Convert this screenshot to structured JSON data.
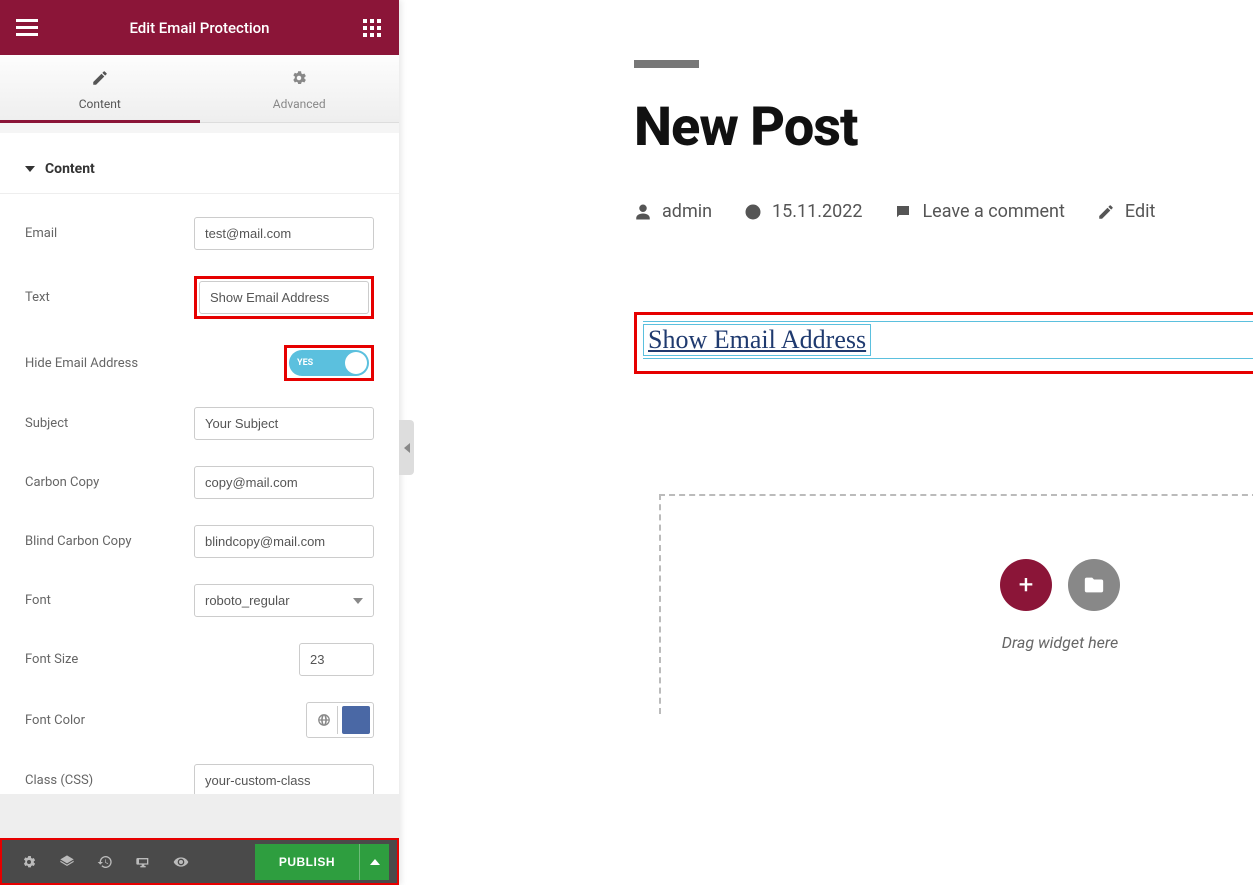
{
  "sidebar": {
    "title": "Edit Email Protection",
    "tabs": {
      "content": "Content",
      "advanced": "Advanced"
    },
    "section": "Content",
    "fields": {
      "email_label": "Email",
      "email_value": "test@mail.com",
      "text_label": "Text",
      "text_value": "Show Email Address",
      "hide_label": "Hide Email Address",
      "hide_toggle": "YES",
      "subject_label": "Subject",
      "subject_value": "Your Subject",
      "cc_label": "Carbon Copy",
      "cc_value": "copy@mail.com",
      "bcc_label": "Blind Carbon Copy",
      "bcc_value": "blindcopy@mail.com",
      "font_label": "Font",
      "font_value": "roboto_regular",
      "fontsize_label": "Font Size",
      "fontsize_value": "23",
      "fontcolor_label": "Font Color",
      "fontcolor_value": "#4a68a5",
      "class_label": "Class (CSS)",
      "class_value": "your-custom-class"
    },
    "footer": {
      "publish": "PUBLISH"
    }
  },
  "canvas": {
    "title": "New Post",
    "meta": {
      "author": "admin",
      "date": "15.11.2022",
      "comments": "Leave a comment",
      "edit": "Edit"
    },
    "widget_link": "Show Email Address",
    "drop_text": "Drag widget here"
  }
}
